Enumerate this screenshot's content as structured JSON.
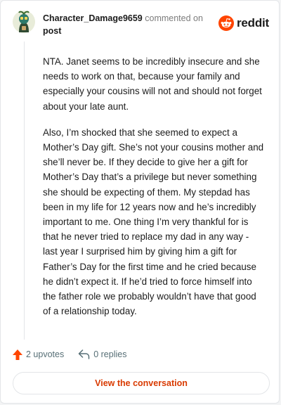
{
  "header": {
    "username": "Character_Damage9659",
    "commented_on": "commented on",
    "post_link": "post",
    "brand": "reddit"
  },
  "comment": {
    "paragraphs": [
      "NTA. Janet seems to be incredibly insecure and she needs to work on that, because your family and especially your cousins will not and should not forget about your late aunt.",
      "Also, I’m shocked that she seemed to expect a Mother’s Day gift. She’s not your cousins mother and she’ll never be. If they decide to give her a gift for Mother’s Day that’s a privilege but never something she should be expecting of them. My stepdad has been in my life for 12 years now and he’s incredibly important to me. One thing I’m very thankful for is that he never tried to replace my dad in any way - last year I surprised him by giving him a gift for Father’s Day for the first time and he cried because he didn’t expect it. If he’d tried to force himself into the father role we probably wouldn’t have that good of a relationship today."
    ]
  },
  "actions": {
    "upvotes": "2 upvotes",
    "replies": "0 replies"
  },
  "footer": {
    "view_conversation": "View the conversation"
  },
  "icons": {
    "upvote": "upvote-arrow-icon",
    "reply": "reply-arrow-icon",
    "brand": "reddit-snoo-icon",
    "avatar": "user-avatar"
  },
  "colors": {
    "brand_orange": "#ff4500",
    "link_red": "#d93a00",
    "muted": "#576f76"
  }
}
